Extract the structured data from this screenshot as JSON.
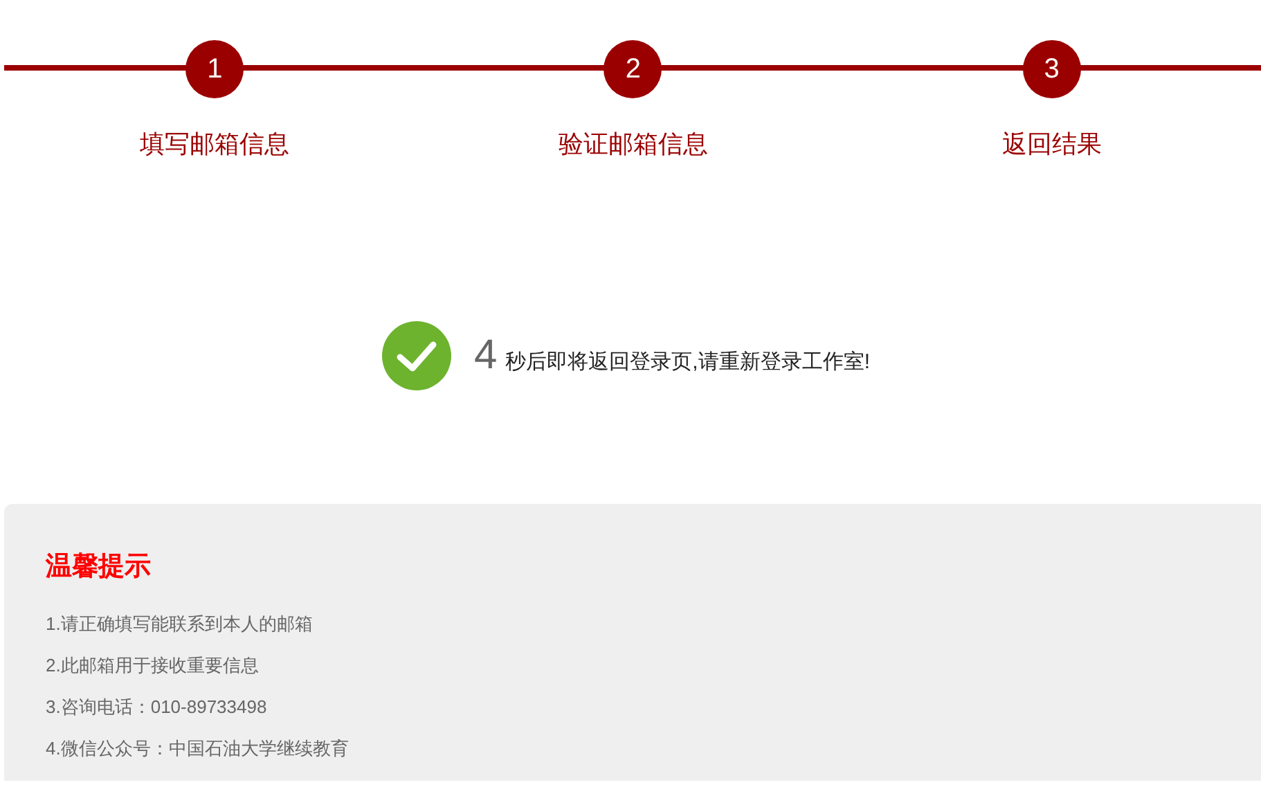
{
  "steps": [
    {
      "number": "1",
      "label": "填写邮箱信息",
      "completed": true
    },
    {
      "number": "2",
      "label": "验证邮箱信息",
      "completed": true
    },
    {
      "number": "3",
      "label": "返回结果",
      "completed": true
    }
  ],
  "result": {
    "countdown": "4",
    "message": "秒后即将返回登录页,请重新登录工作室!"
  },
  "tips": {
    "title": "温馨提示",
    "items": [
      "1.请正确填写能联系到本人的邮箱",
      "2.此邮箱用于接收重要信息",
      "3.咨询电话：010-89733498",
      "4.微信公众号：中国石油大学继续教育"
    ]
  }
}
